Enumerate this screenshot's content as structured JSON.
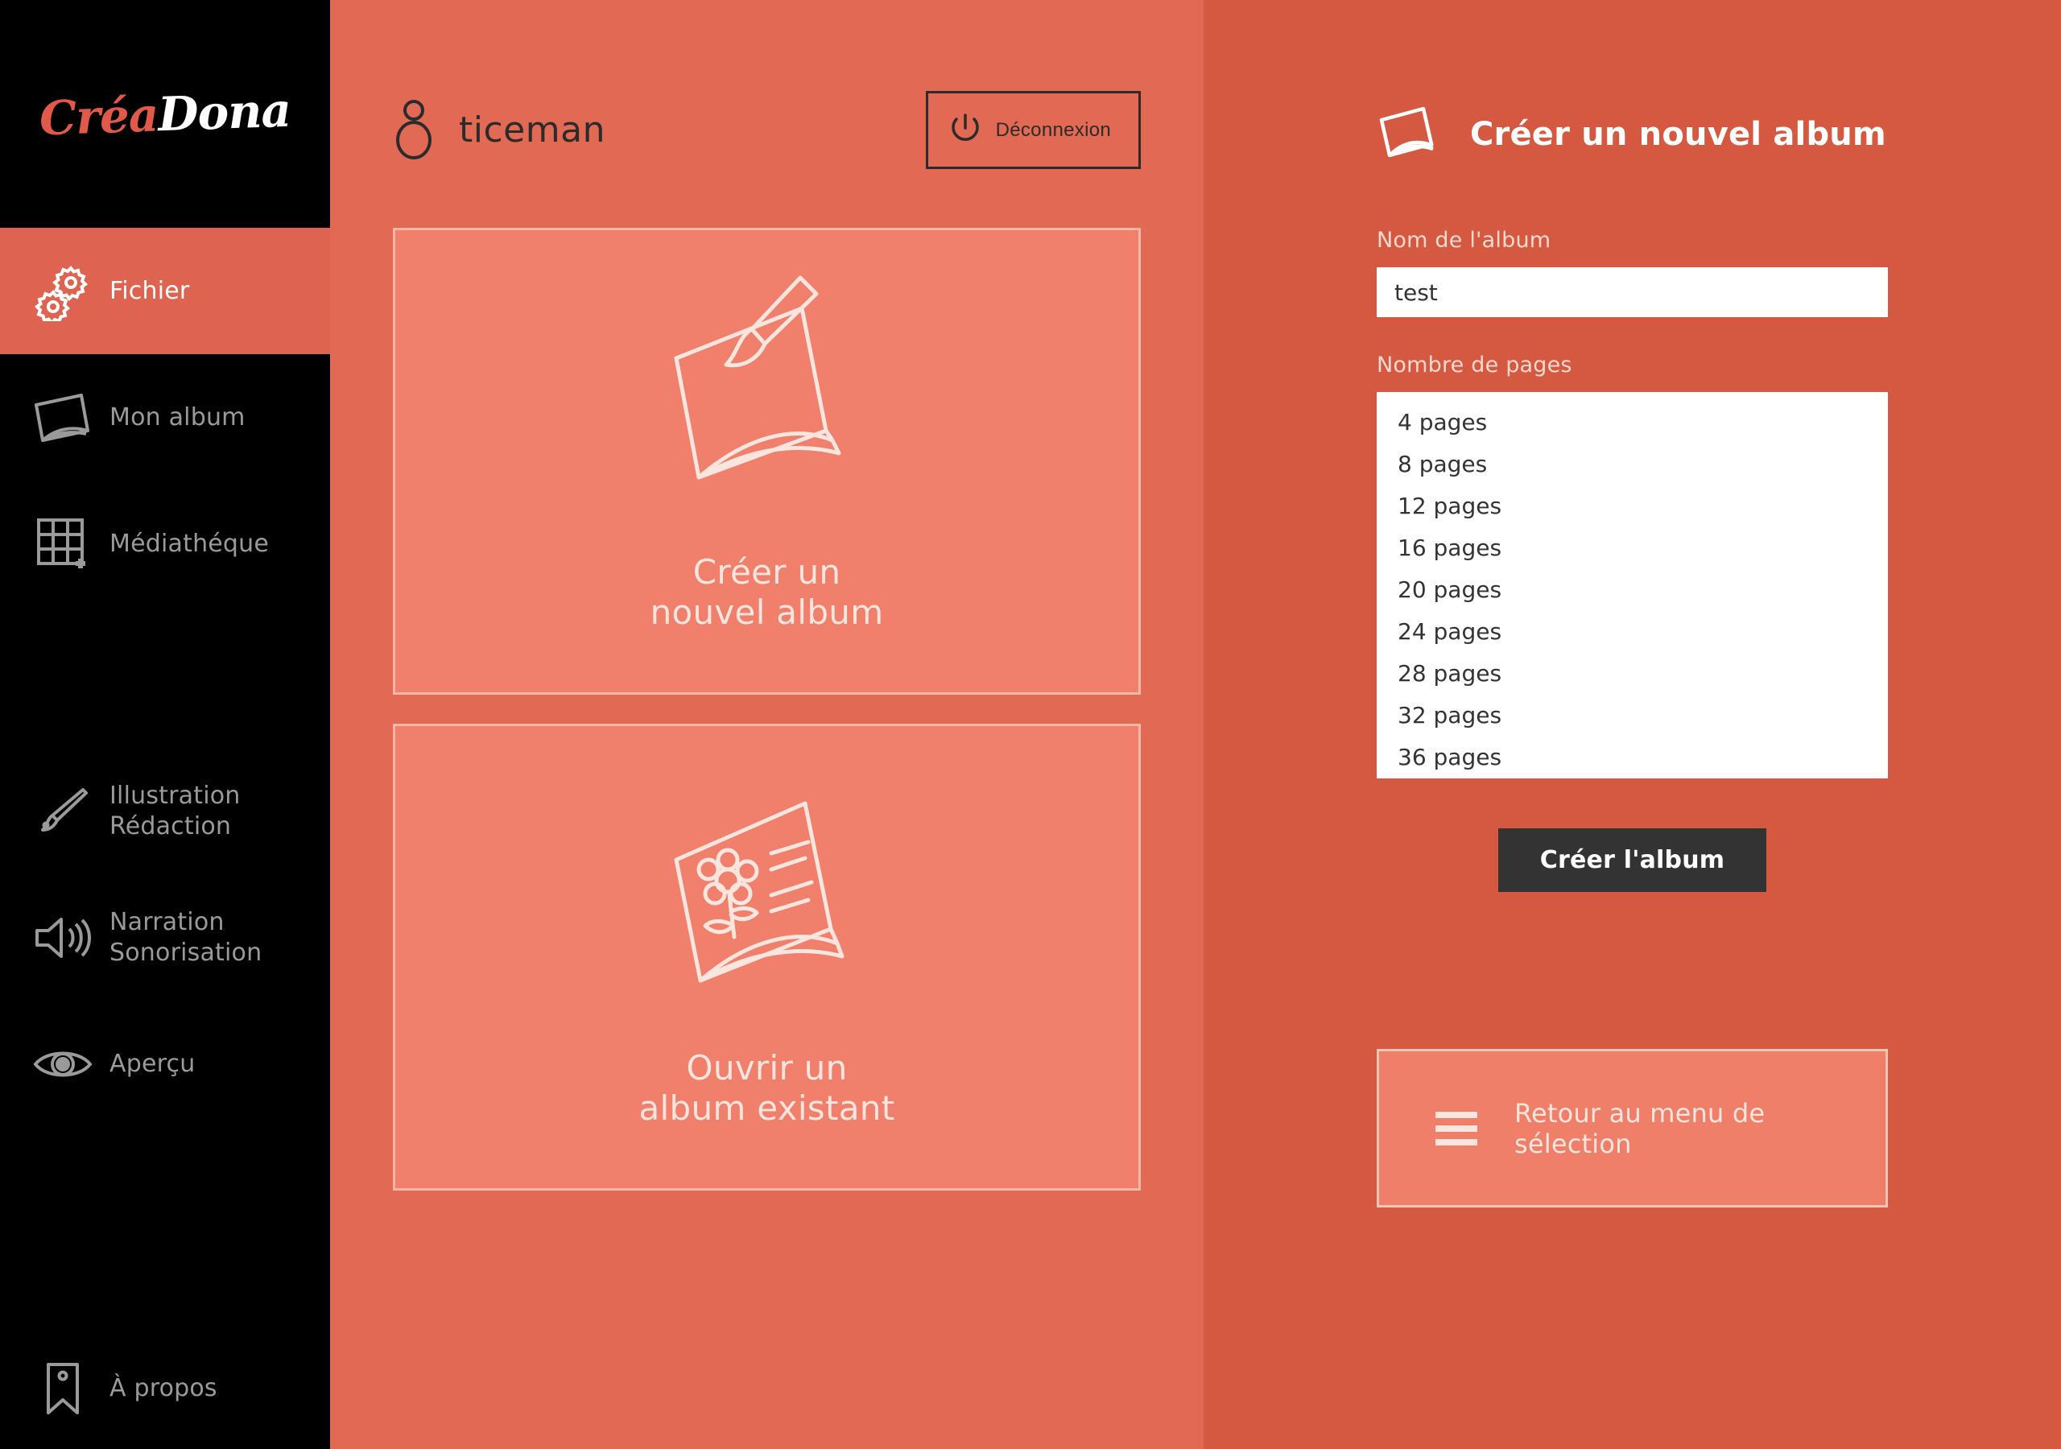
{
  "brand": {
    "part1": "Créa",
    "part2": "Dona"
  },
  "sidebar": {
    "items": [
      {
        "label": "Fichier",
        "icon": "gears-icon",
        "active": true
      },
      {
        "label": "Mon album",
        "icon": "book-icon",
        "active": false
      },
      {
        "label": "Médiathéque",
        "icon": "grid-plus-icon",
        "active": false
      },
      {
        "label": "Illustration\nRédaction",
        "icon": "paintbrush-icon",
        "active": false
      },
      {
        "label": "Narration\nSonorisation",
        "icon": "speaker-icon",
        "active": false
      },
      {
        "label": "Aperçu",
        "icon": "eye-icon",
        "active": false
      },
      {
        "label": "À propos",
        "icon": "bookmark-icon",
        "active": false
      }
    ]
  },
  "header": {
    "username": "ticeman",
    "user_icon": "person-icon",
    "logout_label": "Déconnexion",
    "logout_icon": "power-icon"
  },
  "main": {
    "cards": [
      {
        "caption": "Créer un\nnouvel album",
        "icon": "book-paintbrush-icon"
      },
      {
        "caption": "Ouvrir un\nalbum existant",
        "icon": "book-flower-icon"
      }
    ]
  },
  "panel": {
    "title": "Créer un nouvel album",
    "title_icon": "book-icon",
    "album_name_label": "Nom de l'album",
    "album_name_value": "test",
    "album_name_placeholder": "",
    "pages_label": "Nombre de pages",
    "pages_options": [
      "4 pages",
      "8 pages",
      "12 pages",
      "16 pages",
      "20 pages",
      "24 pages",
      "28 pages",
      "32 pages",
      "36 pages"
    ],
    "create_button": "Créer l'album",
    "back_button": "Retour au menu de sélection",
    "back_icon": "hamburger-icon"
  },
  "colors": {
    "sidebar_bg": "#000000",
    "sidebar_active": "#de6350",
    "middle_bg": "#e26954",
    "right_bg": "#d55840",
    "card_bg": "#f07f6b",
    "card_border": "#f6b6a8",
    "accent_text": "#fde5df",
    "dark_button": "#333333",
    "logo_accent": "#e2594a"
  }
}
